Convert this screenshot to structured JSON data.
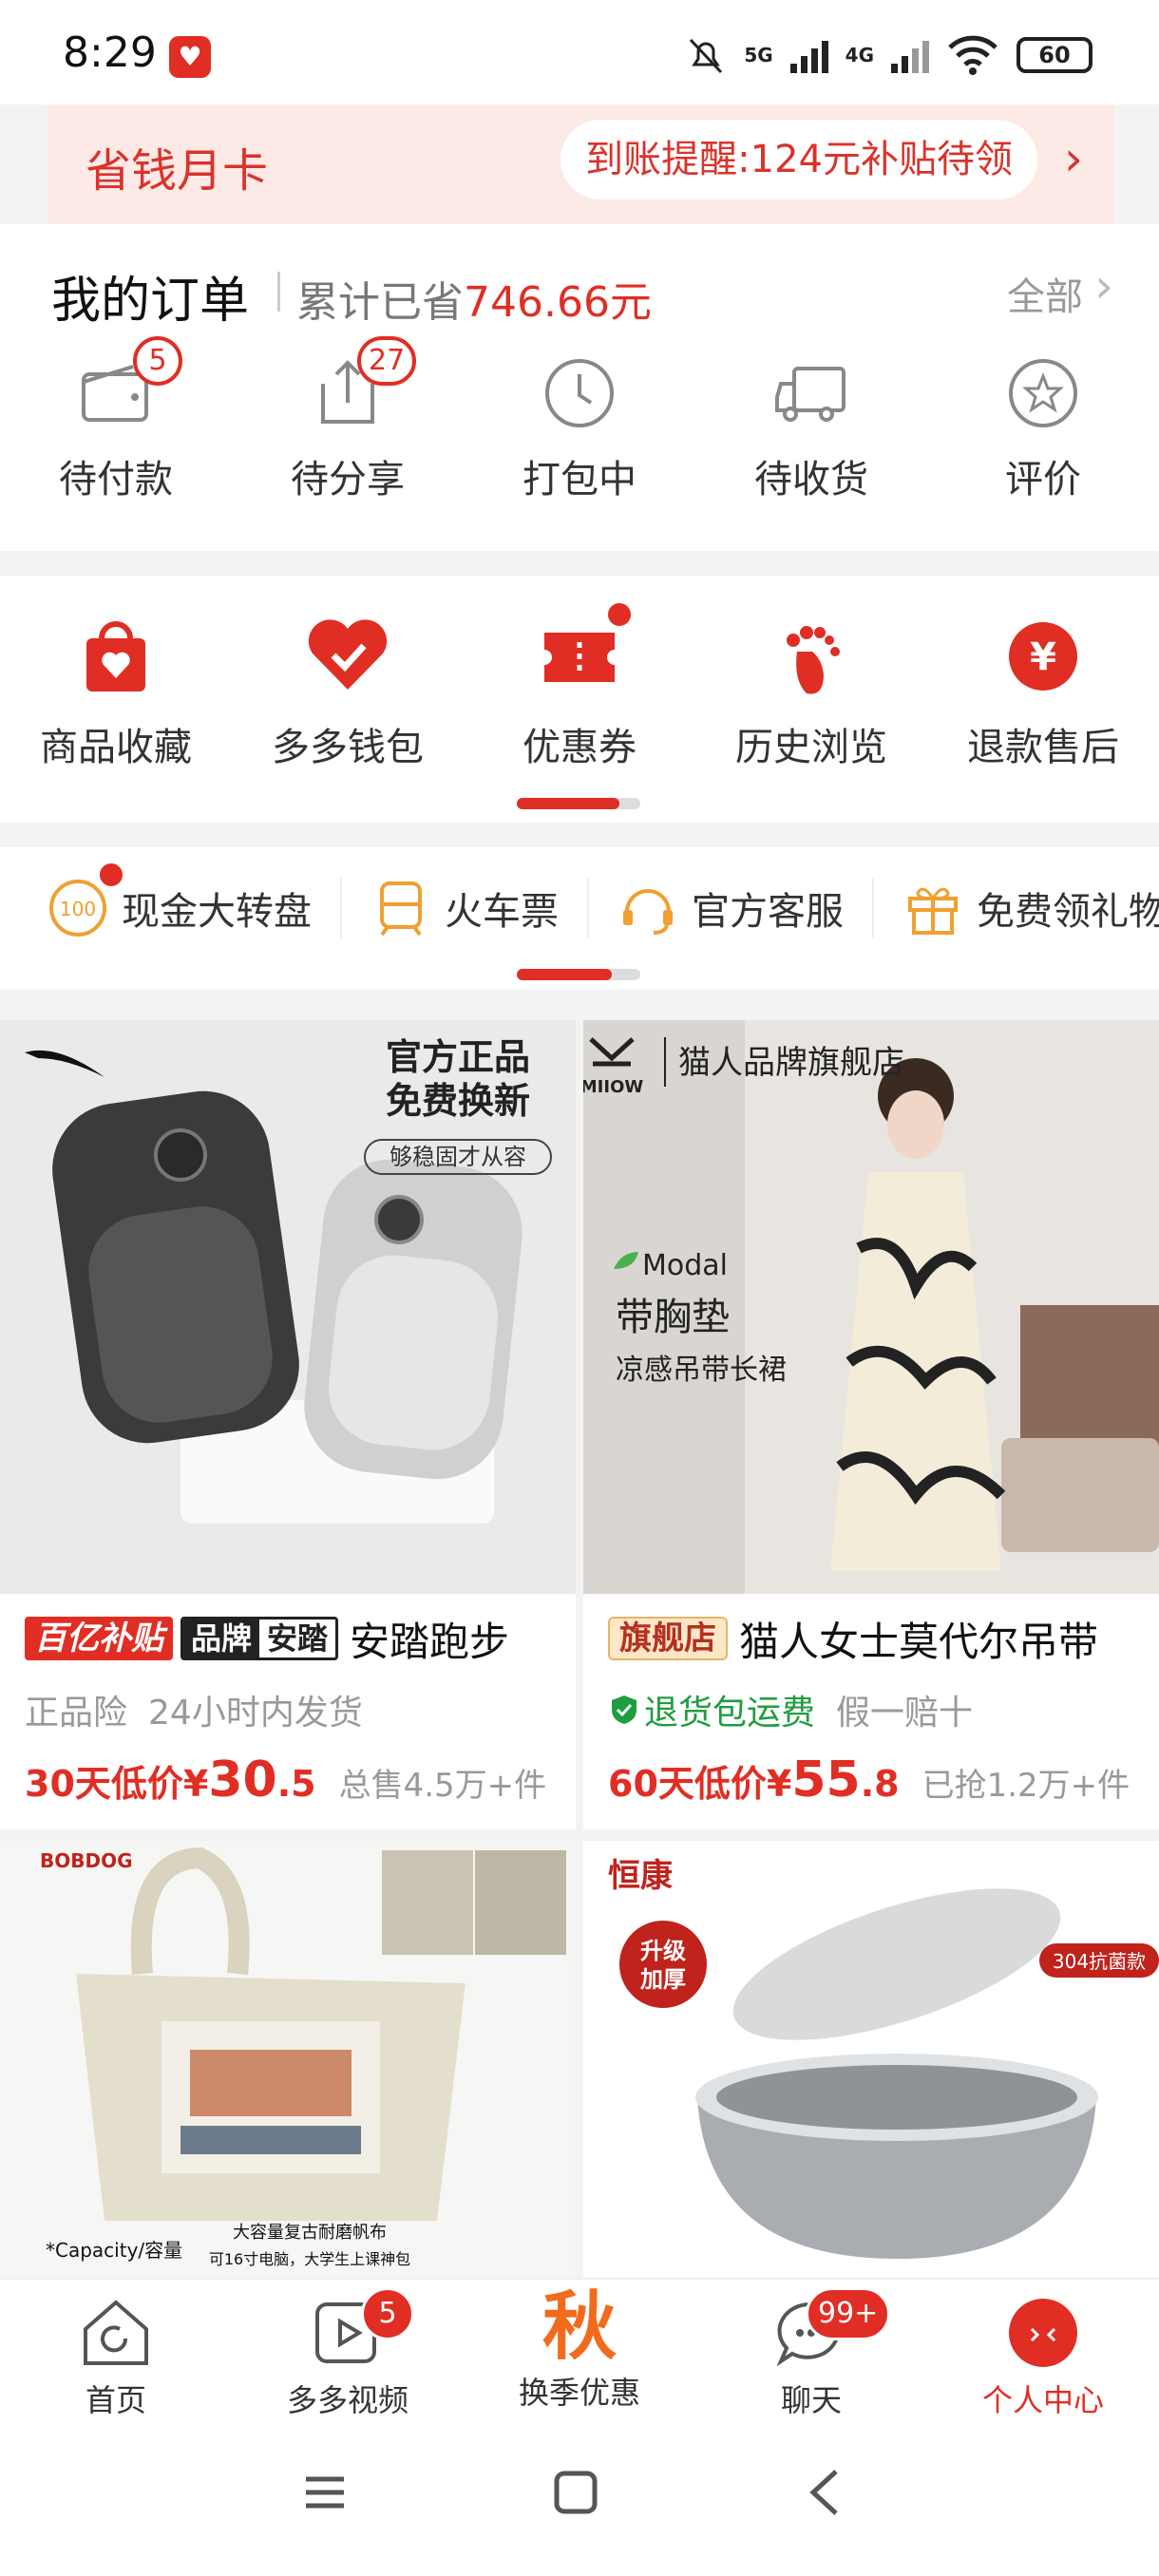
{
  "status_bar": {
    "time": "8:29",
    "network_1": "5G",
    "network_2": "4G",
    "battery": "60"
  },
  "banner": {
    "title": "省钱月卡",
    "notice": "到账提醒:124元补贴待领"
  },
  "orders": {
    "title": "我的订单",
    "saved_prefix": "累计已省",
    "saved_amount": "746.66元",
    "all_label": "全部",
    "items": [
      {
        "label": "待付款",
        "badge": "5",
        "icon": "wallet-icon"
      },
      {
        "label": "待分享",
        "badge": "27",
        "icon": "share-icon"
      },
      {
        "label": "打包中",
        "badge": "",
        "icon": "clock-icon"
      },
      {
        "label": "待收货",
        "badge": "",
        "icon": "truck-icon"
      },
      {
        "label": "评价",
        "badge": "",
        "icon": "star-comment-icon"
      }
    ]
  },
  "tools": {
    "items": [
      {
        "label": "商品收藏",
        "icon": "favorite-bag-icon"
      },
      {
        "label": "多多钱包",
        "icon": "wallet-heart-icon"
      },
      {
        "label": "优惠券",
        "icon": "coupon-icon"
      },
      {
        "label": "历史浏览",
        "icon": "footprint-icon"
      },
      {
        "label": "退款售后",
        "icon": "refund-icon"
      }
    ]
  },
  "quick_links": {
    "items": [
      {
        "label": "现金大转盘",
        "icon": "wheel-100-icon"
      },
      {
        "label": "火车票",
        "icon": "train-icon"
      },
      {
        "label": "官方客服",
        "icon": "headset-icon"
      },
      {
        "label": "免费领礼物",
        "icon": "gift-icon"
      }
    ]
  },
  "products": [
    {
      "image_texts": {
        "headline1": "官方正品",
        "headline2": "免费换新",
        "pill": "够稳固才从容"
      },
      "tag": "百亿补贴",
      "brand_tag_1": "品牌",
      "brand_tag_2": "安踏",
      "name": "安踏跑步",
      "sub_1": "正品险",
      "sub_2": "24小时内发货",
      "price_label": "30天低价¥",
      "price_int": "30",
      "price_dec": ".5",
      "sold": "总售4.5万+件"
    },
    {
      "image_texts": {
        "brand": "猫人品牌旗舰店",
        "logo": "MIIOW",
        "material": "Modal",
        "line1": "带胸垫",
        "line2": "凉感吊带长裙"
      },
      "tag": "旗舰店",
      "name": "猫人女士莫代尔吊带",
      "sub_1": "退货包运费",
      "sub_2": "假一赔十",
      "price_label": "60天低价¥",
      "price_int": "55",
      "price_dec": ".8",
      "sold": "已抢1.2万+件"
    },
    {
      "image_texts": {
        "logo": "BOBDOG",
        "caption1": "大容量复古耐磨帆布",
        "caption2": "可16寸电脑，大学生上课神包",
        "capacity": "*Capacity/容量"
      }
    },
    {
      "image_texts": {
        "logo": "恒康",
        "badge1": "升级",
        "badge2": "加厚",
        "label": "304抗菌款"
      }
    }
  ],
  "bottom_nav": {
    "items": [
      {
        "label": "首页",
        "icon": "home-icon",
        "badge": ""
      },
      {
        "label": "多多视频",
        "icon": "video-icon",
        "badge": "5"
      },
      {
        "label": "换季优惠",
        "icon": "season-text-icon",
        "badge": "",
        "big_text": "秋"
      },
      {
        "label": "聊天",
        "icon": "chat-icon",
        "badge": "99+"
      },
      {
        "label": "个人中心",
        "icon": "profile-icon",
        "badge": "",
        "active": true
      }
    ]
  },
  "colors": {
    "accent": "#e02e24",
    "banner_bg": "#fde9e6",
    "season": "#f26b1d"
  }
}
